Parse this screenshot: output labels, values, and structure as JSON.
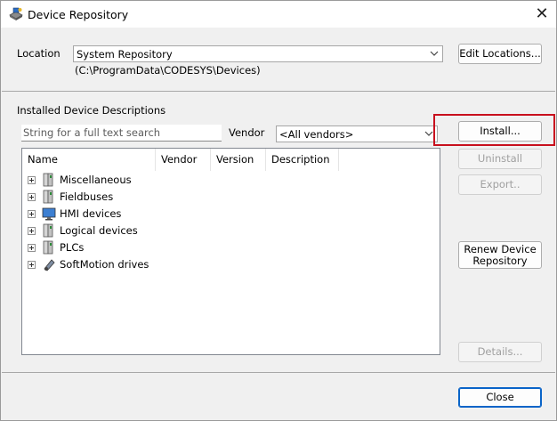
{
  "window": {
    "title": "Device Repository"
  },
  "location": {
    "label": "Location",
    "selected": "System Repository",
    "path": "(C:\\ProgramData\\CODESYS\\Devices)",
    "edit_button": "Edit Locations..."
  },
  "installed": {
    "section_label": "Installed Device Descriptions",
    "search_placeholder": "String for a full text search",
    "vendor_label": "Vendor",
    "vendor_selected": "<All vendors>",
    "columns": [
      "Name",
      "Vendor",
      "Version",
      "Description"
    ],
    "items": [
      {
        "label": "Miscellaneous",
        "icon": "device-module-icon"
      },
      {
        "label": "Fieldbuses",
        "icon": "device-module-icon"
      },
      {
        "label": "HMI devices",
        "icon": "hmi-monitor-icon"
      },
      {
        "label": "Logical devices",
        "icon": "device-module-icon"
      },
      {
        "label": "PLCs",
        "icon": "device-module-icon"
      },
      {
        "label": "SoftMotion drives",
        "icon": "softmotion-drive-icon"
      }
    ]
  },
  "buttons": {
    "install": "Install...",
    "uninstall": "Uninstall",
    "export": "Export..",
    "renew_line1": "Renew Device",
    "renew_line2": "Repository",
    "details": "Details...",
    "close": "Close"
  },
  "colors": {
    "highlight": "#c8101e",
    "accent": "#0a64c8"
  }
}
